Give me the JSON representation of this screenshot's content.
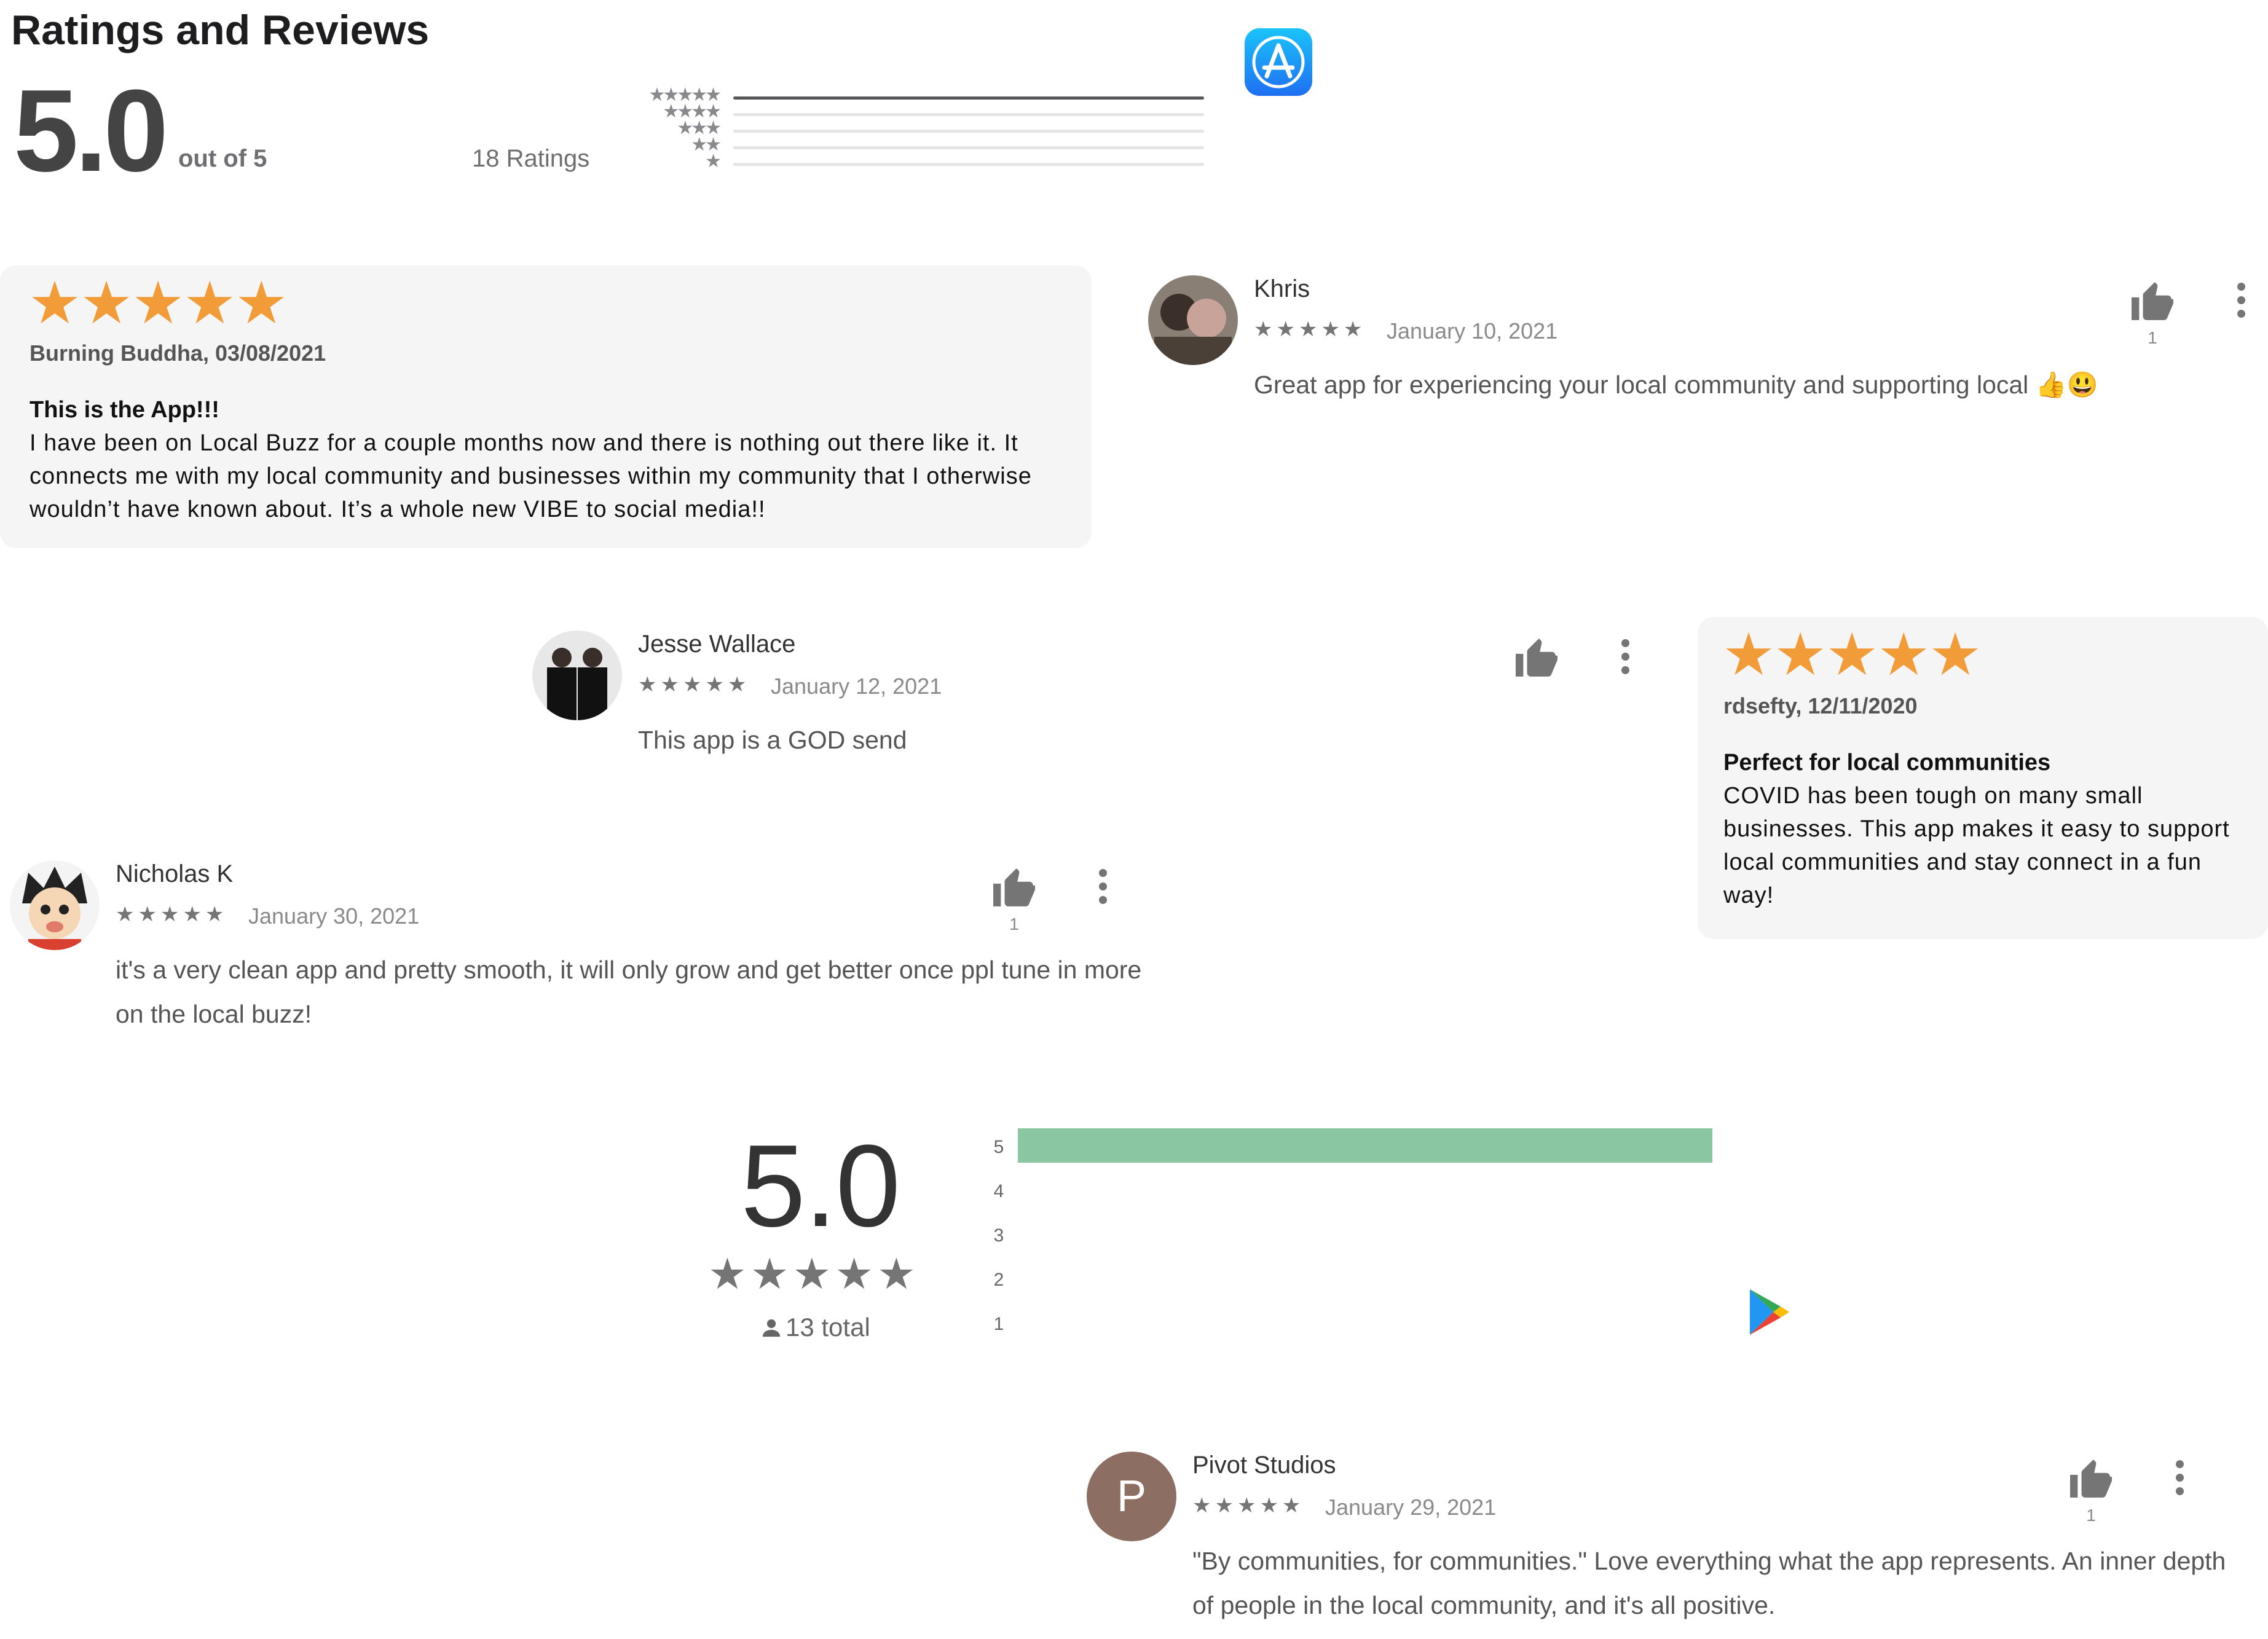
{
  "appstore": {
    "title": "Ratings and Reviews",
    "score": "5.0",
    "out_of": "out of 5",
    "ratings_count": "18 Ratings",
    "histogram": [
      {
        "stars": "★★★★★",
        "fraction": 1.0
      },
      {
        "stars": "★★★★",
        "fraction": 0
      },
      {
        "stars": "★★★",
        "fraction": 0
      },
      {
        "stars": "★★",
        "fraction": 0
      },
      {
        "stars": "★",
        "fraction": 0
      }
    ],
    "icon": "app-store-icon"
  },
  "cards": [
    {
      "stars": "★★★★★",
      "byline": "Burning Buddha, 03/08/2021",
      "title": "This is the App!!!",
      "body": "I have been on Local Buzz for a couple months now and there is nothing out there like it. It connects me with my local community and businesses within my community that I otherwise wouldn’t have known about. It’s a whole new VIBE to social media!!"
    },
    {
      "stars": "★★★★★",
      "byline": "rdsefty, 12/11/2020",
      "title": "Perfect for local communities",
      "body": "COVID has been tough on many small businesses. This app makes it easy to support local communities and stay connect in a fun way!"
    }
  ],
  "reviews": [
    {
      "name": "Khris",
      "stars": "★★★★★",
      "date": "January 10, 2021",
      "text": "Great app for experiencing your local community and supporting local 👍😃",
      "likes": "1"
    },
    {
      "name": "Jesse Wallace",
      "stars": "★★★★★",
      "date": "January 12, 2021",
      "text": "This app is a GOD send",
      "likes": ""
    },
    {
      "name": "Nicholas K",
      "stars": "★★★★★",
      "date": "January 30, 2021",
      "text": "it's a very clean app and pretty smooth, it will only grow and get better once ppl tune in more on the local buzz!",
      "likes": "1"
    },
    {
      "name": "Pivot Studios",
      "avatar_letter": "P",
      "stars": "★★★★★",
      "date": "January 29, 2021",
      "text": "\"By communities, for communities.\" Love everything what the app represents. An inner depth of people in the local community, and it's all positive.",
      "likes": "1"
    }
  ],
  "googleplay": {
    "score": "5.0",
    "stars": "★★★★★",
    "total": "13 total",
    "histogram": [
      {
        "label": "5",
        "fraction": 1.0
      },
      {
        "label": "4",
        "fraction": 0
      },
      {
        "label": "3",
        "fraction": 0
      },
      {
        "label": "2",
        "fraction": 0
      },
      {
        "label": "1",
        "fraction": 0
      }
    ],
    "bar_color": "#8bc6a2",
    "icon": "google-play-icon"
  },
  "colors": {
    "accent_star": "#f19c38",
    "avatar_p": "#8d6e63"
  }
}
